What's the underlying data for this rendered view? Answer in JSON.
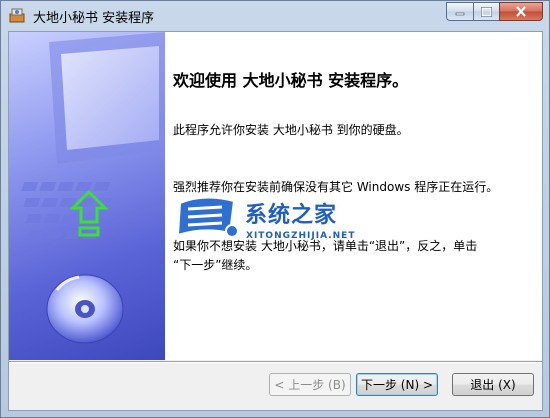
{
  "window": {
    "title": "大地小秘书 安装程序"
  },
  "content": {
    "heading": "欢迎使用 大地小秘书 安装程序。",
    "paragraph1": "此程序允许你安装 大地小秘书 到你的硬盘。",
    "paragraph2": "强烈推荐你在安装前确保没有其它 Windows 程序正在运行。",
    "paragraph3_line1": "如果你不想安装 大地小秘书，请单击“退出”，反之，单击",
    "paragraph3_line2": "“下一步”继续。"
  },
  "watermark": {
    "text": "系统之家",
    "subtext": "XITONGZHIJIA.NET"
  },
  "buttons": {
    "back": "< 上一步 (B)",
    "next": "下一步 (N) >",
    "exit": "退出 (X)"
  },
  "colors": {
    "accent": "#1f5fbf",
    "banner_dark": "#3e48bd",
    "banner_light": "#c9d0ff",
    "arrow_green": "#38e038"
  },
  "icons": {
    "app": "installer-icon",
    "minimize": "minimize-icon",
    "maximize": "maximize-icon",
    "close": "close-icon",
    "banner_arrow": "up-arrow-icon",
    "banner_disc": "cd-disc-icon"
  }
}
